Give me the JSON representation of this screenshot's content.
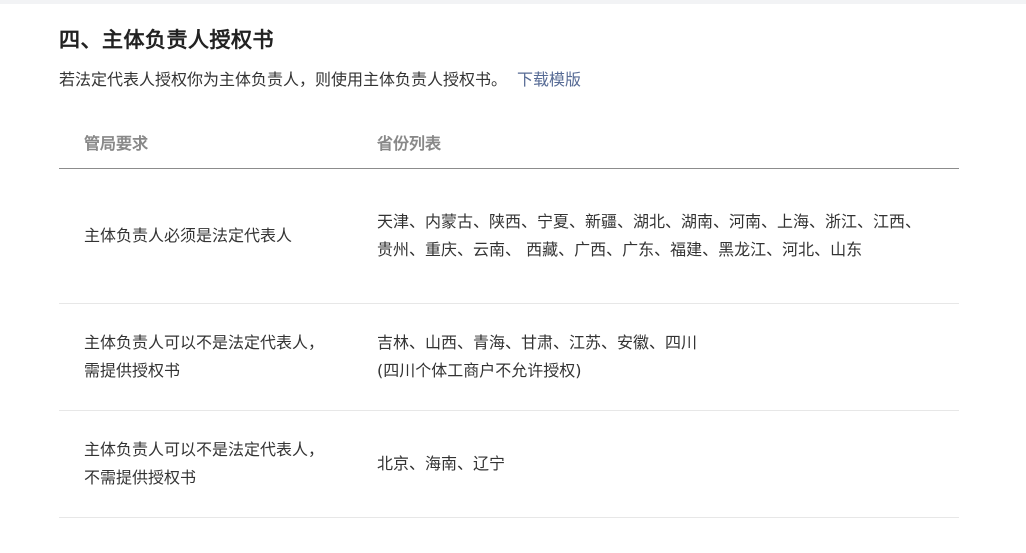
{
  "section": {
    "title": "四、主体负责人授权书",
    "description": "若法定代表人授权你为主体负责人，则使用主体负责人授权书。",
    "download_link": "下载模版"
  },
  "table": {
    "headers": [
      "管局要求",
      "省份列表"
    ],
    "rows": [
      {
        "requirement": "主体负责人必须是法定代表人",
        "provinces": "天津、内蒙古、陕西、宁夏、新疆、湖北、湖南、河南、上海、浙江、江西、贵州、重庆、云南、 西藏、广西、广东、福建、黑龙江、河北、山东",
        "note": ""
      },
      {
        "requirement": "主体负责人可以不是法定代表人，需提供授权书",
        "provinces": "吉林、山西、青海、甘肃、江苏、安徽、四川",
        "note": "(四川个体工商户不允许授权)"
      },
      {
        "requirement": "主体负责人可以不是法定代表人，不需提供授权书",
        "provinces": "北京、海南、辽宁",
        "note": ""
      }
    ]
  }
}
